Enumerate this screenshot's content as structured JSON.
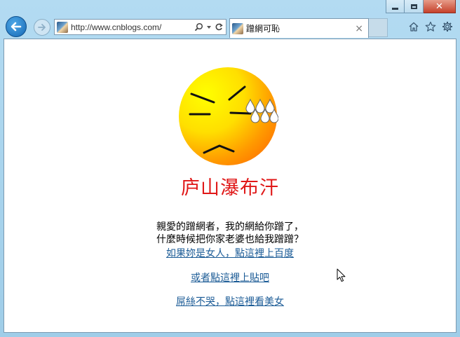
{
  "browser": {
    "url": "http://www.cnblogs.com/",
    "tab_title": "蹭網可恥",
    "tab_close": "×",
    "close_glyph": "✕"
  },
  "page": {
    "headline": "庐山瀑布汗",
    "message_lines": [
      "親愛的蹭網者，我的網給你蹭了，",
      "什麼時候把你家老婆也給我蹭蹭？"
    ],
    "links": [
      "如果妳是女人，點這裡上百度",
      "或者點這裡上貼吧",
      "屌絲不哭，點這裡看美女"
    ]
  },
  "colors": {
    "headline": "#e01818",
    "link": "#1b5b96",
    "back_button": "#1668b4"
  },
  "icons": [
    "back-arrow-icon",
    "forward-arrow-icon",
    "search-icon",
    "dropdown-icon",
    "refresh-icon",
    "home-icon",
    "star-icon",
    "gear-icon",
    "sweating-emoji-icon",
    "mouse-cursor-icon"
  ]
}
